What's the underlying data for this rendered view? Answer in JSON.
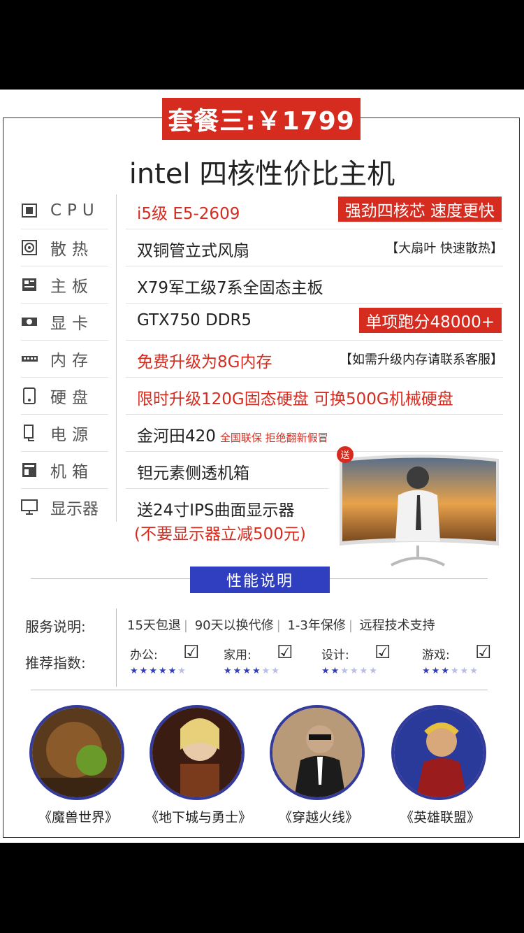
{
  "package": {
    "label": "套餐三:￥1799"
  },
  "title": "intel 四核性价比主机",
  "specs": [
    {
      "label": "CPU",
      "icon": "cpu-icon",
      "value": "i5级 E5-2609",
      "red": true,
      "tag": "强劲四核芯 速度更快"
    },
    {
      "label": "散热",
      "icon": "fan-icon",
      "value": "双铜管立式风扇",
      "note": "【大扇叶 快速散热】"
    },
    {
      "label": "主板",
      "icon": "motherboard-icon",
      "value": "X79军工级7系全固态主板"
    },
    {
      "label": "显卡",
      "icon": "gpu-icon",
      "value": "GTX750 DDR5",
      "tag": "单项跑分48000+"
    },
    {
      "label": "内存",
      "icon": "memory-icon",
      "value": "免费升级为8G内存",
      "red": true,
      "note": "【如需升级内存请联系客服】"
    },
    {
      "label": "硬盘",
      "icon": "disk-icon",
      "value": "限时升级120G固态硬盘 可换500G机械硬盘",
      "red": true
    },
    {
      "label": "电源",
      "icon": "power-icon",
      "value": "金河田420",
      "small": "全国联保 拒绝翻新假冒"
    },
    {
      "label": "机箱",
      "icon": "case-icon",
      "value": "钽元素侧透机箱"
    },
    {
      "label": "显示器",
      "icon": "monitor-icon",
      "value": "送24寸IPS曲面显示器",
      "value2": "(不要显示器立减500元)"
    }
  ],
  "monitor_badge": "送",
  "performance": {
    "label": "性能说明"
  },
  "service": {
    "label": "服务说明:",
    "items": [
      "15天包退",
      "90天以换代修",
      "1-3年保修",
      "远程技术支持"
    ]
  },
  "recommend": {
    "label": "推荐指数:",
    "items": [
      {
        "name": "办公:",
        "stars": 5,
        "max": 6
      },
      {
        "name": "家用:",
        "stars": 4,
        "max": 6
      },
      {
        "name": "设计:",
        "stars": 2,
        "max": 6
      },
      {
        "name": "游戏:",
        "stars": 3,
        "max": 6
      }
    ]
  },
  "games": [
    "《魔兽世界》",
    "《地下城与勇士》",
    "《穿越火线》",
    "《英雄联盟》"
  ],
  "colors": {
    "accent_red": "#d62b1f",
    "accent_blue": "#2f3fbf"
  }
}
